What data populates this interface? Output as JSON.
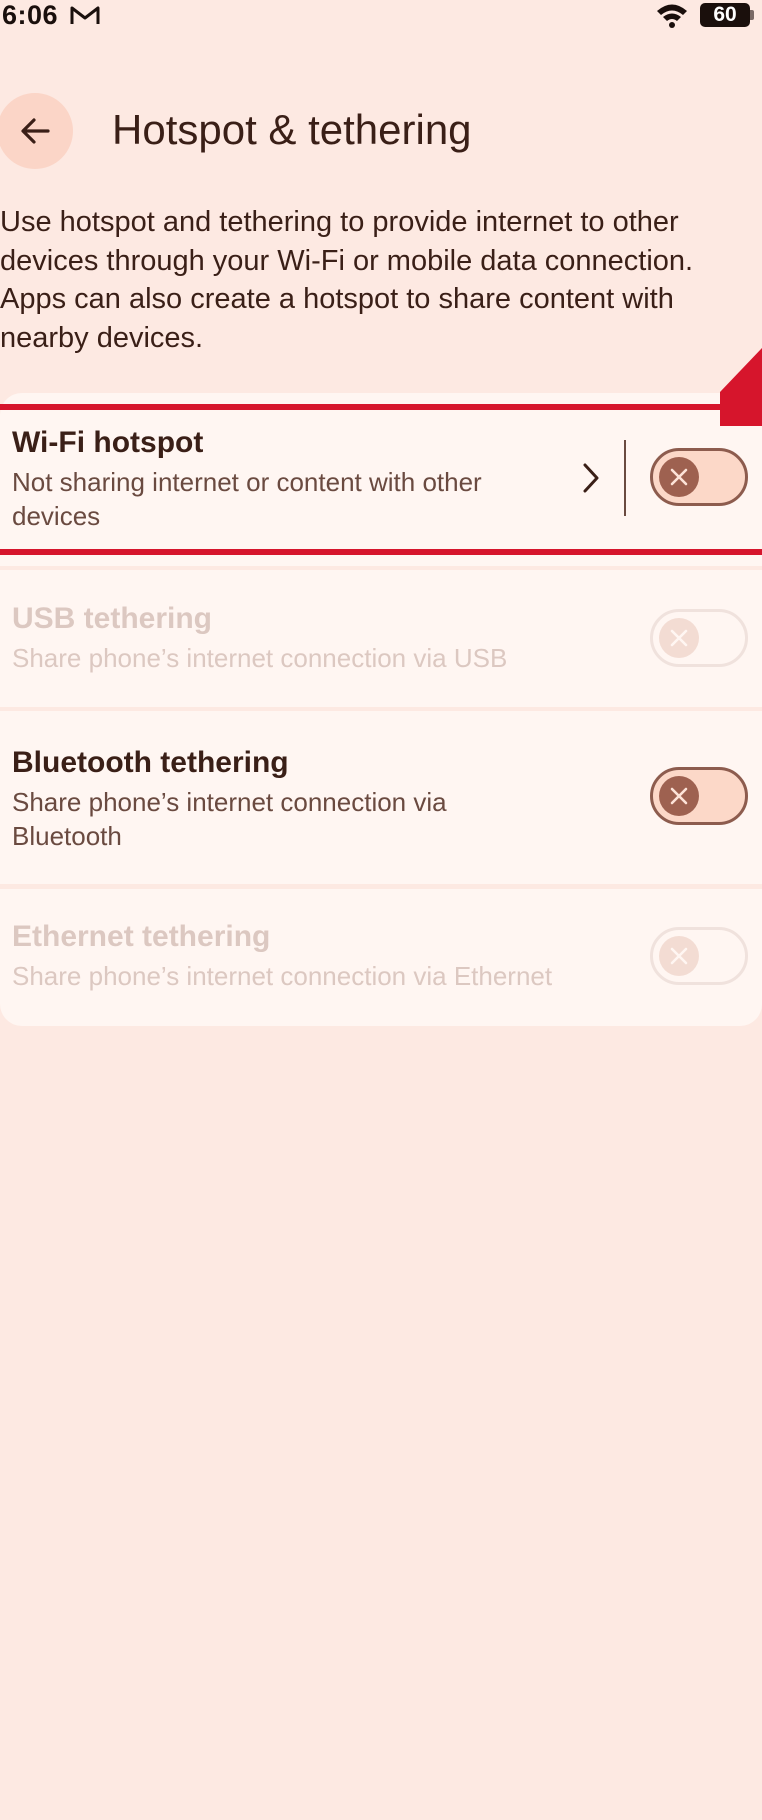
{
  "status_bar": {
    "time": "6:06",
    "battery": "60",
    "icons": [
      "gmail-icon",
      "wifi-icon",
      "battery-icon"
    ]
  },
  "header": {
    "title": "Hotspot & tethering",
    "back_icon": "arrow-back-icon"
  },
  "description": "Use hotspot and tethering to provide internet to other devices through your Wi-Fi or mobile data connection. Apps can also create a hotspot to share content with nearby devices.",
  "settings": [
    {
      "title": "Wi-Fi hotspot",
      "subtitle": "Not sharing internet or content with other devices",
      "enabled": true,
      "toggle_on": false
    },
    {
      "title": "USB tethering",
      "subtitle": "Share phone’s internet connection via USB",
      "enabled": false,
      "toggle_on": false
    },
    {
      "title": "Bluetooth tethering",
      "subtitle": "Share phone’s internet connection via Bluetooth",
      "enabled": true,
      "toggle_on": false
    },
    {
      "title": "Ethernet tethering",
      "subtitle": "Share phone’s internet connection via Ethernet",
      "enabled": false,
      "toggle_on": false
    }
  ],
  "colors": {
    "background": "#fde9e2",
    "card": "#fff6f2",
    "text_primary": "#3a1f17",
    "text_secondary": "#6a4a40",
    "toggle_knob": "#9e6150",
    "highlight": "#d6152c"
  }
}
